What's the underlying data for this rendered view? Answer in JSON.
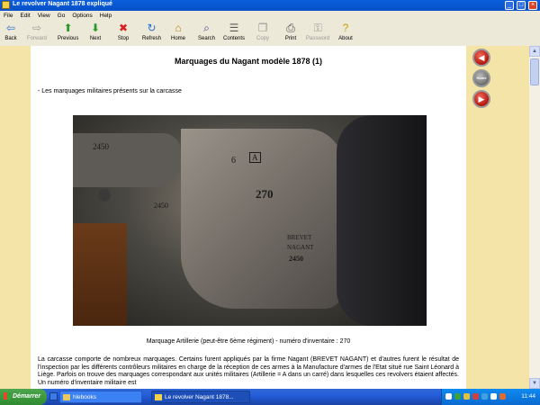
{
  "window": {
    "title": "Le revolver Nagant 1878 expliqué"
  },
  "menu": [
    "File",
    "Edit",
    "View",
    "Go",
    "Options",
    "Help"
  ],
  "toolbar": [
    {
      "label": "Back",
      "icon": "back-arrow-icon",
      "glyph": "⇦",
      "color": "#2a6fd4",
      "enabled": true
    },
    {
      "label": "Forward",
      "icon": "forward-arrow-icon",
      "glyph": "⇨",
      "color": "#9a9a9a",
      "enabled": false
    },
    {
      "label": "Previous",
      "icon": "up-arrow-icon",
      "glyph": "⬆",
      "color": "#2a9a2a",
      "enabled": true
    },
    {
      "label": "Next",
      "icon": "down-arrow-icon",
      "glyph": "⬇",
      "color": "#2a9a2a",
      "enabled": true
    },
    {
      "label": "Stop",
      "icon": "stop-icon",
      "glyph": "✖",
      "color": "#d42020",
      "enabled": true
    },
    {
      "label": "Refresh",
      "icon": "refresh-icon",
      "glyph": "↻",
      "color": "#2a6fd4",
      "enabled": true
    },
    {
      "label": "Home",
      "icon": "home-icon",
      "glyph": "⌂",
      "color": "#b8860b",
      "enabled": true
    },
    {
      "label": "Search",
      "icon": "search-icon",
      "glyph": "⌕",
      "color": "#3a3a8a",
      "enabled": true
    },
    {
      "label": "Contents",
      "icon": "contents-icon",
      "glyph": "☰",
      "color": "#5a5a5a",
      "enabled": true
    },
    {
      "label": "Copy",
      "icon": "copy-icon",
      "glyph": "❐",
      "color": "#9a9a9a",
      "enabled": false
    },
    {
      "label": "Print",
      "icon": "print-icon",
      "glyph": "⎙",
      "color": "#4a4a4a",
      "enabled": true
    },
    {
      "label": "Password",
      "icon": "password-icon",
      "glyph": "⚿",
      "color": "#9a9a9a",
      "enabled": false
    },
    {
      "label": "About",
      "icon": "about-icon",
      "glyph": "?",
      "color": "#c8a000",
      "enabled": true
    }
  ],
  "page": {
    "title": "Marquages du Nagant modèle 1878 (1)",
    "subheading": "- Les marquages militaires présents sur la carcasse",
    "caption": "Marquage Artillerie (peut-être 6ème régiment) - numéro d'inventaire : 270",
    "body": "La carcasse comporte de nombreux marquages. Certains furent appliqués par la firme Nagant (BREVET NAGANT) et d'autres furent le résultat de l'inspection par les différents contrôleurs militaires en charge de la réception de ces armes à la Manufacture d'armes de l'Etat situé rue Saint Léonard à Liège. Parfois on trouve des marquages correspondant aux unités militaires (Artillerie = A dans un carré) dans lesquelles ces revolvers étaient affectés. Un numéro d'inventaire militaire est",
    "photo_marks": {
      "serial_top": "2450",
      "serial_mid": "2450",
      "regiment": "6",
      "arsenal": "A",
      "inventory": "270",
      "brevet1": "BREVET",
      "brevet2": "NAGANT",
      "brevet_serial": "2450"
    }
  },
  "nav": {
    "home_label": "Home"
  },
  "taskbar": {
    "start": "Démarrer",
    "tasks": [
      {
        "label": "hlebooks",
        "active": false
      },
      {
        "label": "Le revolver Nagant 1878...",
        "active": true
      }
    ],
    "clock": "11:44"
  }
}
